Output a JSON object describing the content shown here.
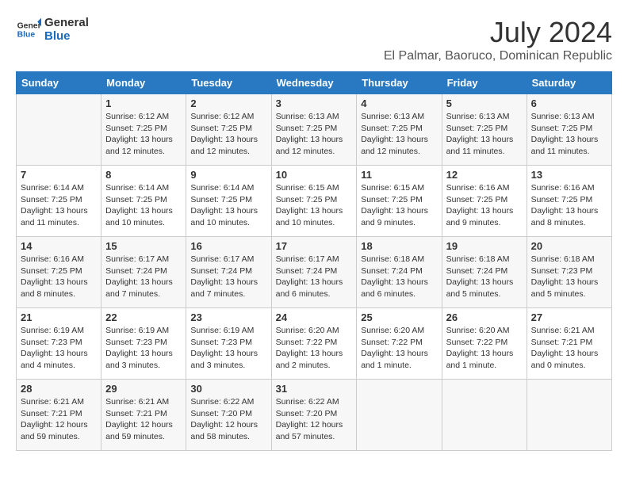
{
  "logo": {
    "line1": "General",
    "line2": "Blue"
  },
  "title": "July 2024",
  "subtitle": "El Palmar, Baoruco, Dominican Republic",
  "days_of_week": [
    "Sunday",
    "Monday",
    "Tuesday",
    "Wednesday",
    "Thursday",
    "Friday",
    "Saturday"
  ],
  "weeks": [
    [
      {
        "day": "",
        "info": ""
      },
      {
        "day": "1",
        "info": "Sunrise: 6:12 AM\nSunset: 7:25 PM\nDaylight: 13 hours\nand 12 minutes."
      },
      {
        "day": "2",
        "info": "Sunrise: 6:12 AM\nSunset: 7:25 PM\nDaylight: 13 hours\nand 12 minutes."
      },
      {
        "day": "3",
        "info": "Sunrise: 6:13 AM\nSunset: 7:25 PM\nDaylight: 13 hours\nand 12 minutes."
      },
      {
        "day": "4",
        "info": "Sunrise: 6:13 AM\nSunset: 7:25 PM\nDaylight: 13 hours\nand 12 minutes."
      },
      {
        "day": "5",
        "info": "Sunrise: 6:13 AM\nSunset: 7:25 PM\nDaylight: 13 hours\nand 11 minutes."
      },
      {
        "day": "6",
        "info": "Sunrise: 6:13 AM\nSunset: 7:25 PM\nDaylight: 13 hours\nand 11 minutes."
      }
    ],
    [
      {
        "day": "7",
        "info": "Sunrise: 6:14 AM\nSunset: 7:25 PM\nDaylight: 13 hours\nand 11 minutes."
      },
      {
        "day": "8",
        "info": "Sunrise: 6:14 AM\nSunset: 7:25 PM\nDaylight: 13 hours\nand 10 minutes."
      },
      {
        "day": "9",
        "info": "Sunrise: 6:14 AM\nSunset: 7:25 PM\nDaylight: 13 hours\nand 10 minutes."
      },
      {
        "day": "10",
        "info": "Sunrise: 6:15 AM\nSunset: 7:25 PM\nDaylight: 13 hours\nand 10 minutes."
      },
      {
        "day": "11",
        "info": "Sunrise: 6:15 AM\nSunset: 7:25 PM\nDaylight: 13 hours\nand 9 minutes."
      },
      {
        "day": "12",
        "info": "Sunrise: 6:16 AM\nSunset: 7:25 PM\nDaylight: 13 hours\nand 9 minutes."
      },
      {
        "day": "13",
        "info": "Sunrise: 6:16 AM\nSunset: 7:25 PM\nDaylight: 13 hours\nand 8 minutes."
      }
    ],
    [
      {
        "day": "14",
        "info": "Sunrise: 6:16 AM\nSunset: 7:25 PM\nDaylight: 13 hours\nand 8 minutes."
      },
      {
        "day": "15",
        "info": "Sunrise: 6:17 AM\nSunset: 7:24 PM\nDaylight: 13 hours\nand 7 minutes."
      },
      {
        "day": "16",
        "info": "Sunrise: 6:17 AM\nSunset: 7:24 PM\nDaylight: 13 hours\nand 7 minutes."
      },
      {
        "day": "17",
        "info": "Sunrise: 6:17 AM\nSunset: 7:24 PM\nDaylight: 13 hours\nand 6 minutes."
      },
      {
        "day": "18",
        "info": "Sunrise: 6:18 AM\nSunset: 7:24 PM\nDaylight: 13 hours\nand 6 minutes."
      },
      {
        "day": "19",
        "info": "Sunrise: 6:18 AM\nSunset: 7:24 PM\nDaylight: 13 hours\nand 5 minutes."
      },
      {
        "day": "20",
        "info": "Sunrise: 6:18 AM\nSunset: 7:23 PM\nDaylight: 13 hours\nand 5 minutes."
      }
    ],
    [
      {
        "day": "21",
        "info": "Sunrise: 6:19 AM\nSunset: 7:23 PM\nDaylight: 13 hours\nand 4 minutes."
      },
      {
        "day": "22",
        "info": "Sunrise: 6:19 AM\nSunset: 7:23 PM\nDaylight: 13 hours\nand 3 minutes."
      },
      {
        "day": "23",
        "info": "Sunrise: 6:19 AM\nSunset: 7:23 PM\nDaylight: 13 hours\nand 3 minutes."
      },
      {
        "day": "24",
        "info": "Sunrise: 6:20 AM\nSunset: 7:22 PM\nDaylight: 13 hours\nand 2 minutes."
      },
      {
        "day": "25",
        "info": "Sunrise: 6:20 AM\nSunset: 7:22 PM\nDaylight: 13 hours\nand 1 minute."
      },
      {
        "day": "26",
        "info": "Sunrise: 6:20 AM\nSunset: 7:22 PM\nDaylight: 13 hours\nand 1 minute."
      },
      {
        "day": "27",
        "info": "Sunrise: 6:21 AM\nSunset: 7:21 PM\nDaylight: 13 hours\nand 0 minutes."
      }
    ],
    [
      {
        "day": "28",
        "info": "Sunrise: 6:21 AM\nSunset: 7:21 PM\nDaylight: 12 hours\nand 59 minutes."
      },
      {
        "day": "29",
        "info": "Sunrise: 6:21 AM\nSunset: 7:21 PM\nDaylight: 12 hours\nand 59 minutes."
      },
      {
        "day": "30",
        "info": "Sunrise: 6:22 AM\nSunset: 7:20 PM\nDaylight: 12 hours\nand 58 minutes."
      },
      {
        "day": "31",
        "info": "Sunrise: 6:22 AM\nSunset: 7:20 PM\nDaylight: 12 hours\nand 57 minutes."
      },
      {
        "day": "",
        "info": ""
      },
      {
        "day": "",
        "info": ""
      },
      {
        "day": "",
        "info": ""
      }
    ]
  ]
}
